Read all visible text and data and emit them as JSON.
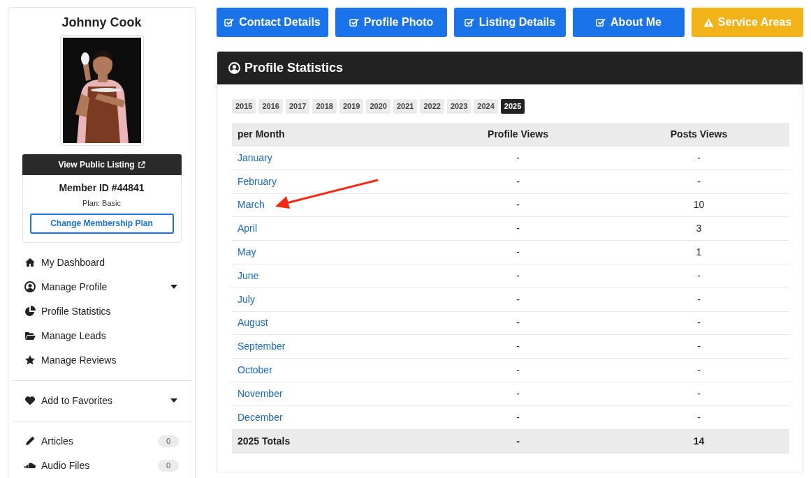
{
  "sidebar": {
    "name": "Johnny Cook",
    "view_listing": "View Public Listing",
    "member_id": "Member ID #44841",
    "plan": "Plan: Basic",
    "change_plan": "Change Membership Plan",
    "menu": [
      {
        "kind": "home",
        "label": "My Dashboard",
        "has_dropdown": false
      },
      {
        "kind": "user",
        "label": "Manage Profile",
        "has_dropdown": true
      },
      {
        "kind": "pie",
        "label": "Profile Statistics",
        "has_dropdown": false
      },
      {
        "kind": "folder",
        "label": "Manage Leads",
        "has_dropdown": false
      },
      {
        "kind": "star",
        "label": "Manage Reviews",
        "has_dropdown": false
      }
    ],
    "favorites": {
      "kind": "heart",
      "label": "Add to Favorites",
      "has_dropdown": true
    },
    "content": [
      {
        "kind": "pencil",
        "label": "Articles",
        "count": "0"
      },
      {
        "kind": "cloud",
        "label": "Audio Files",
        "count": "0"
      }
    ]
  },
  "steps": [
    {
      "kind": "done",
      "label": "Contact Details"
    },
    {
      "kind": "done",
      "label": "Profile Photo"
    },
    {
      "kind": "done",
      "label": "Listing Details"
    },
    {
      "kind": "done",
      "label": "About Me"
    },
    {
      "kind": "warning",
      "label": "Service Areas"
    }
  ],
  "panel": {
    "title": "Profile Statistics",
    "years": [
      {
        "label": "2015",
        "selected": false
      },
      {
        "label": "2016",
        "selected": false
      },
      {
        "label": "2017",
        "selected": false
      },
      {
        "label": "2018",
        "selected": false
      },
      {
        "label": "2019",
        "selected": false
      },
      {
        "label": "2020",
        "selected": false
      },
      {
        "label": "2021",
        "selected": false
      },
      {
        "label": "2022",
        "selected": false
      },
      {
        "label": "2023",
        "selected": false
      },
      {
        "label": "2024",
        "selected": false
      },
      {
        "label": "2025",
        "selected": true
      }
    ],
    "table": {
      "columns": [
        "per Month",
        "Profile Views",
        "Posts Views"
      ],
      "rows": [
        [
          "January",
          "-",
          "-"
        ],
        [
          "February",
          "-",
          "-"
        ],
        [
          "March",
          "-",
          "10"
        ],
        [
          "April",
          "-",
          "3"
        ],
        [
          "May",
          "-",
          "1"
        ],
        [
          "June",
          "-",
          "-"
        ],
        [
          "July",
          "-",
          "-"
        ],
        [
          "August",
          "-",
          "-"
        ],
        [
          "September",
          "-",
          "-"
        ],
        [
          "October",
          "-",
          "-"
        ],
        [
          "November",
          "-",
          "-"
        ],
        [
          "December",
          "-",
          "-"
        ]
      ],
      "totals": [
        "2025 Totals",
        "-",
        "14"
      ]
    }
  },
  "annotation": {
    "kind": "arrow"
  }
}
